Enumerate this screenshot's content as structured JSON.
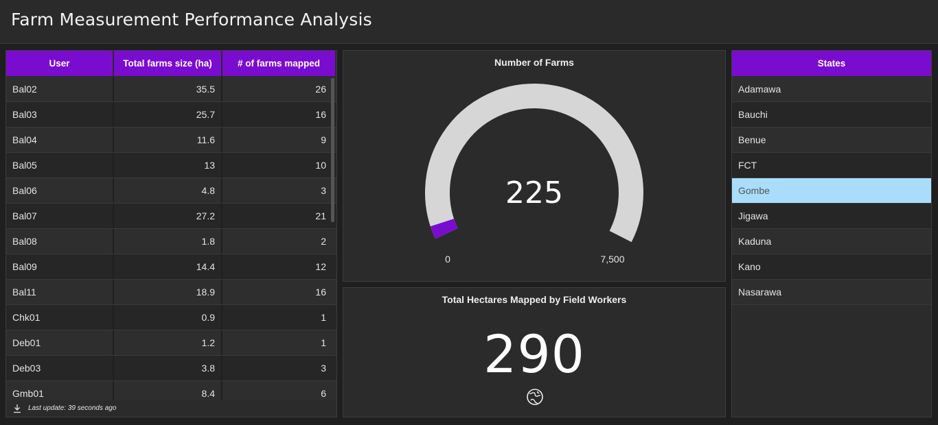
{
  "header": {
    "title": "Farm Measurement Performance Analysis"
  },
  "users_table": {
    "columns": [
      "User",
      "Total farms size (ha)",
      "# of farms mapped"
    ],
    "rows": [
      [
        "Bal02",
        "35.5",
        "26"
      ],
      [
        "Bal03",
        "25.7",
        "16"
      ],
      [
        "Bal04",
        "11.6",
        "9"
      ],
      [
        "Bal05",
        "13",
        "10"
      ],
      [
        "Bal06",
        "4.8",
        "3"
      ],
      [
        "Bal07",
        "27.2",
        "21"
      ],
      [
        "Bal08",
        "1.8",
        "2"
      ],
      [
        "Bal09",
        "14.4",
        "12"
      ],
      [
        "Bal11",
        "18.9",
        "16"
      ],
      [
        "Chk01",
        "0.9",
        "1"
      ],
      [
        "Deb01",
        "1.2",
        "1"
      ],
      [
        "Deb03",
        "3.8",
        "3"
      ],
      [
        "Gmb01",
        "8.4",
        "6"
      ]
    ],
    "footer": "Last update: 39 seconds ago",
    "footer_icon": "download-icon"
  },
  "gauge": {
    "title": "Number of Farms",
    "value": 225,
    "value_label": "225",
    "min": 0,
    "max": 7500,
    "min_label": "0",
    "max_label": "7,500",
    "fill_color": "#7a0ccf",
    "track_color": "#d6d6d6"
  },
  "hectares": {
    "title": "Total Hectares Mapped by Field Workers",
    "value": "290",
    "icon": "globe-icon"
  },
  "states": {
    "header": "States",
    "items": [
      "Adamawa",
      "Bauchi",
      "Benue",
      "FCT",
      "Gombe",
      "Jigawa",
      "Kaduna",
      "Kano",
      "Nasarawa"
    ],
    "selected": "Gombe",
    "selected_color": "#a9ddfb"
  },
  "colors": {
    "accent": "#7a0ccf",
    "background": "#1f1f1f",
    "panel": "#2b2b2b"
  }
}
